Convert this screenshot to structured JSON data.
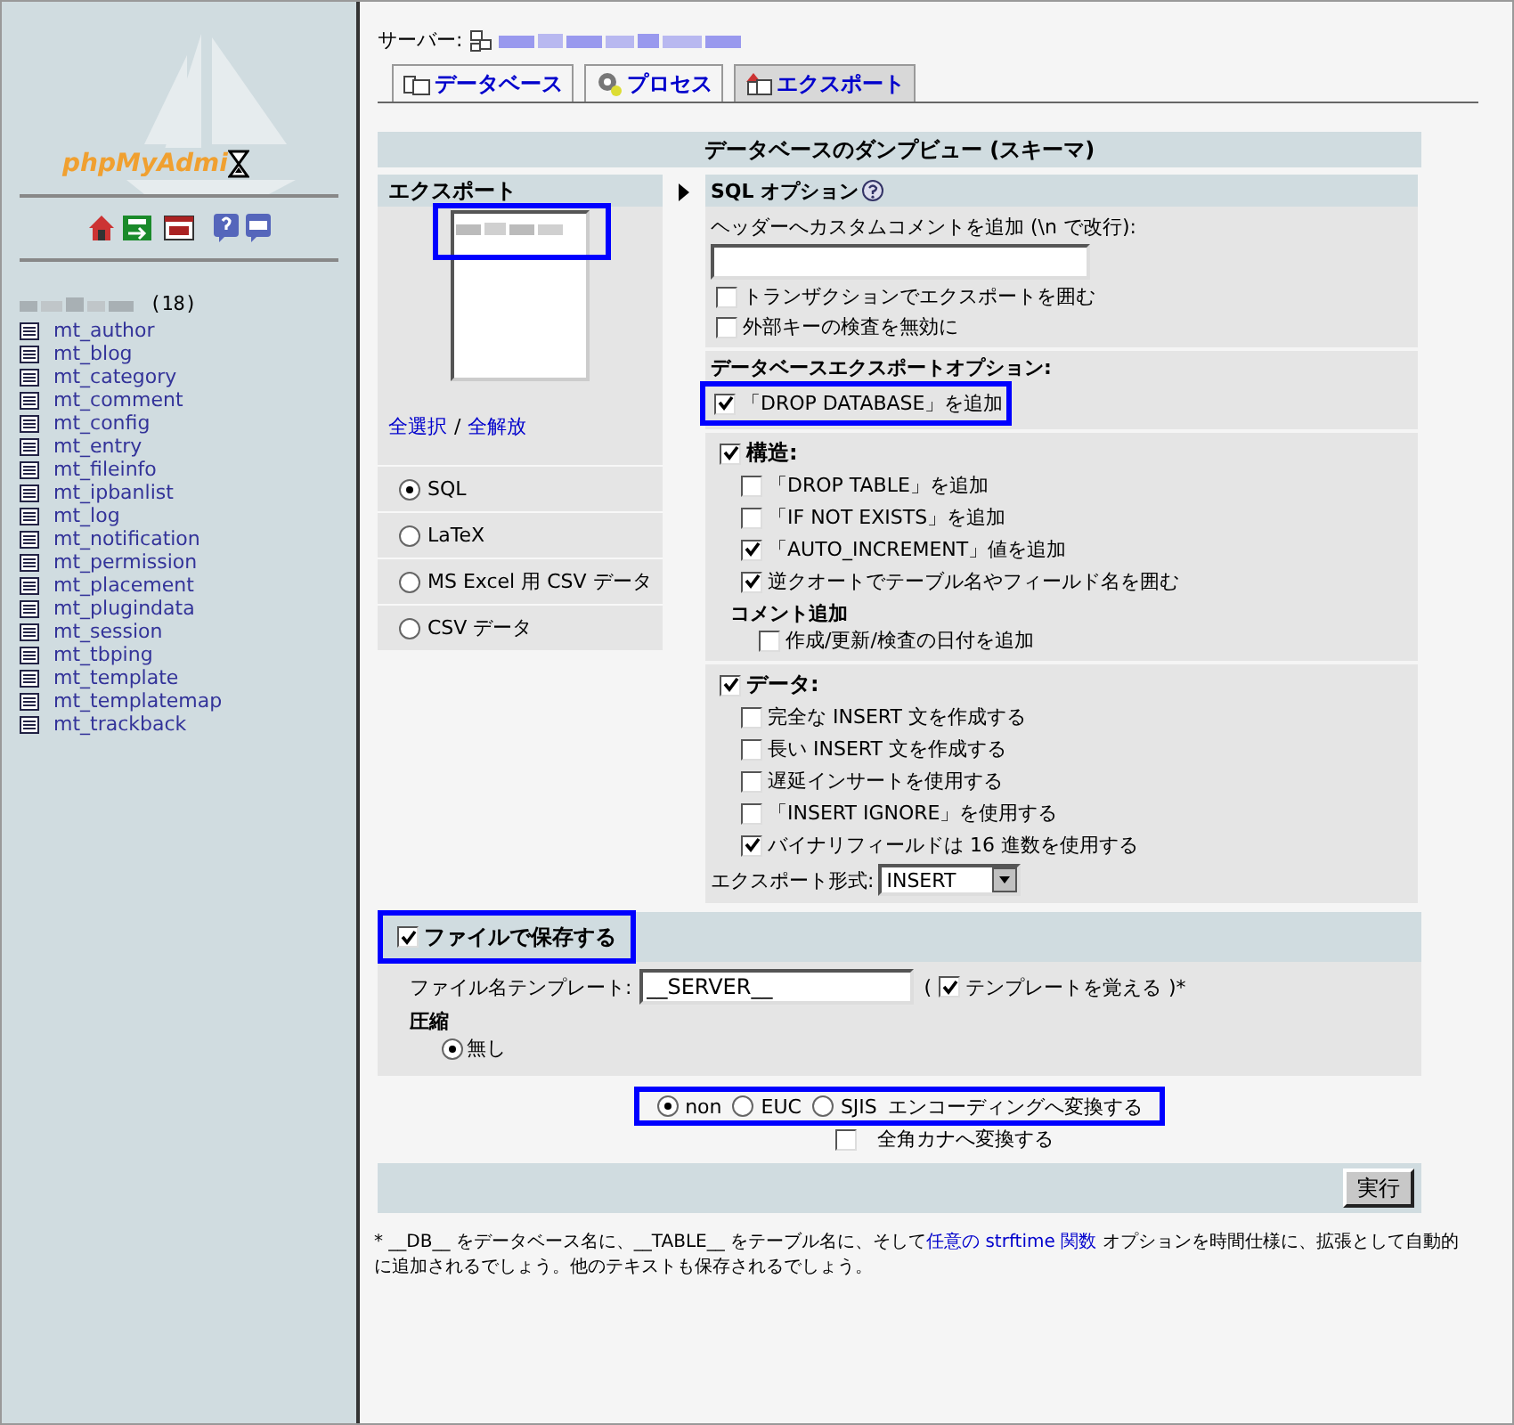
{
  "sidebar": {
    "logo": "phpMyAdmi",
    "db_count": "(18)",
    "tables": [
      "mt_author",
      "mt_blog",
      "mt_category",
      "mt_comment",
      "mt_config",
      "mt_entry",
      "mt_fileinfo",
      "mt_ipbanlist",
      "mt_log",
      "mt_notification",
      "mt_permission",
      "mt_placement",
      "mt_plugindata",
      "mt_session",
      "mt_tbping",
      "mt_template",
      "mt_templatemap",
      "mt_trackback"
    ]
  },
  "server_label": "サーバー:",
  "tabs": [
    {
      "label": "データベース",
      "selected": false
    },
    {
      "label": "プロセス",
      "selected": false
    },
    {
      "label": "エクスポート",
      "selected": true
    }
  ],
  "title": "データベースのダンプビュー (スキーマ)",
  "export": {
    "heading": "エクスポート",
    "select_all": "全選択",
    "separator": "/",
    "deselect_all": "全解放",
    "formats": [
      {
        "label": "SQL",
        "selected": true
      },
      {
        "label": "LaTeX",
        "selected": false
      },
      {
        "label": "MS Excel 用 CSV データ",
        "selected": false
      },
      {
        "label": "CSV データ",
        "selected": false
      }
    ]
  },
  "sql_options": {
    "heading": "SQL オプション",
    "comment_label": "ヘッダーへカスタムコメントを追加 (\\n で改行):",
    "options": [
      {
        "label": "トランザクションでエクスポートを囲む",
        "checked": false
      },
      {
        "label": "外部キーの検査を無効に",
        "checked": false
      }
    ],
    "db_heading": "データベースエクスポートオプション:",
    "drop_database": {
      "label": "「DROP DATABASE」を追加",
      "checked": true
    },
    "structure": {
      "label": "構造:",
      "checked": true,
      "options": [
        {
          "label": "「DROP TABLE」を追加",
          "checked": false
        },
        {
          "label": "「IF NOT EXISTS」を追加",
          "checked": false
        },
        {
          "label": "「AUTO_INCREMENT」値を追加",
          "checked": true
        },
        {
          "label": "逆クオートでテーブル名やフィールド名を囲む",
          "checked": true
        }
      ],
      "comment_heading": "コメント追加",
      "comment_options": [
        {
          "label": "作成/更新/検査の日付を追加",
          "checked": false
        }
      ]
    },
    "data": {
      "label": "データ:",
      "checked": true,
      "options": [
        {
          "label": "完全な INSERT 文を作成する",
          "checked": false
        },
        {
          "label": "長い INSERT 文を作成する",
          "checked": false
        },
        {
          "label": "遅延インサートを使用する",
          "checked": false
        },
        {
          "label": "「INSERT IGNORE」を使用する",
          "checked": false
        },
        {
          "label": "バイナリフィールドは 16 進数を使用する",
          "checked": true
        }
      ]
    },
    "export_format": {
      "label": "エクスポート形式:",
      "value": "INSERT"
    }
  },
  "save": {
    "label": "ファイルで保存する",
    "checked": true,
    "filename_label": "ファイル名テンプレート:",
    "filename": "__SERVER__",
    "remember_open": "(",
    "remember": {
      "label": "テンプレートを覚える",
      "checked": true
    },
    "remember_close": ")*",
    "compression_heading": "圧縮",
    "compression": [
      {
        "label": "無し",
        "selected": true
      }
    ]
  },
  "encoding": {
    "options": [
      {
        "label": "non",
        "selected": true
      },
      {
        "label": "EUC",
        "selected": false
      },
      {
        "label": "SJIS",
        "selected": false
      }
    ],
    "label": "エンコーディングへ変換する"
  },
  "kana": {
    "label": "全角カナへ変換する",
    "checked": false
  },
  "submit": "実行",
  "footnote": {
    "before": "* __DB__ をデータベース名に、__TABLE__ をテーブル名に、そして",
    "link": "任意の strftime 関数",
    "after": " オプションを時間仕様に、拡張として自動的に追加されるでしょう。他のテキストも保存されるでしょう。"
  }
}
